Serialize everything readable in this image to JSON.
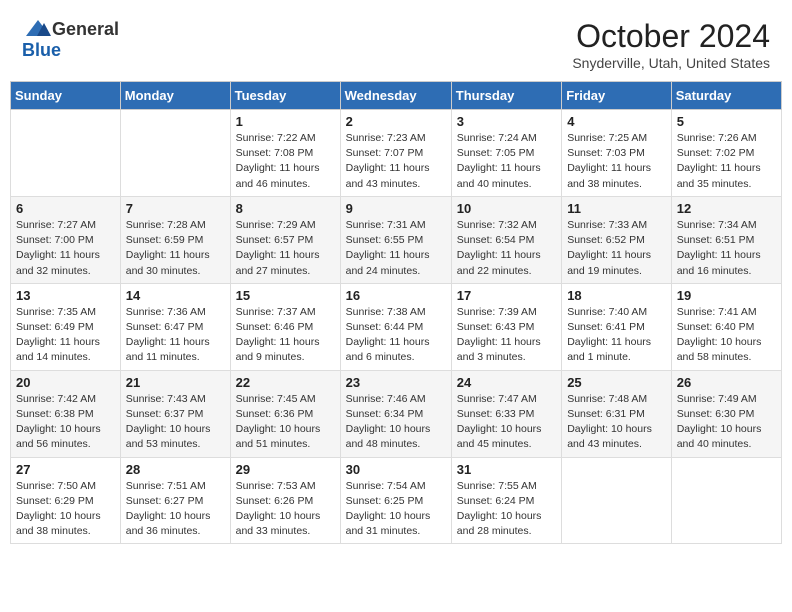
{
  "header": {
    "logo_general": "General",
    "logo_blue": "Blue",
    "month": "October 2024",
    "location": "Snyderville, Utah, United States"
  },
  "days_of_week": [
    "Sunday",
    "Monday",
    "Tuesday",
    "Wednesday",
    "Thursday",
    "Friday",
    "Saturday"
  ],
  "weeks": [
    [
      {
        "day": "",
        "info": ""
      },
      {
        "day": "",
        "info": ""
      },
      {
        "day": "1",
        "info": "Sunrise: 7:22 AM\nSunset: 7:08 PM\nDaylight: 11 hours and 46 minutes."
      },
      {
        "day": "2",
        "info": "Sunrise: 7:23 AM\nSunset: 7:07 PM\nDaylight: 11 hours and 43 minutes."
      },
      {
        "day": "3",
        "info": "Sunrise: 7:24 AM\nSunset: 7:05 PM\nDaylight: 11 hours and 40 minutes."
      },
      {
        "day": "4",
        "info": "Sunrise: 7:25 AM\nSunset: 7:03 PM\nDaylight: 11 hours and 38 minutes."
      },
      {
        "day": "5",
        "info": "Sunrise: 7:26 AM\nSunset: 7:02 PM\nDaylight: 11 hours and 35 minutes."
      }
    ],
    [
      {
        "day": "6",
        "info": "Sunrise: 7:27 AM\nSunset: 7:00 PM\nDaylight: 11 hours and 32 minutes."
      },
      {
        "day": "7",
        "info": "Sunrise: 7:28 AM\nSunset: 6:59 PM\nDaylight: 11 hours and 30 minutes."
      },
      {
        "day": "8",
        "info": "Sunrise: 7:29 AM\nSunset: 6:57 PM\nDaylight: 11 hours and 27 minutes."
      },
      {
        "day": "9",
        "info": "Sunrise: 7:31 AM\nSunset: 6:55 PM\nDaylight: 11 hours and 24 minutes."
      },
      {
        "day": "10",
        "info": "Sunrise: 7:32 AM\nSunset: 6:54 PM\nDaylight: 11 hours and 22 minutes."
      },
      {
        "day": "11",
        "info": "Sunrise: 7:33 AM\nSunset: 6:52 PM\nDaylight: 11 hours and 19 minutes."
      },
      {
        "day": "12",
        "info": "Sunrise: 7:34 AM\nSunset: 6:51 PM\nDaylight: 11 hours and 16 minutes."
      }
    ],
    [
      {
        "day": "13",
        "info": "Sunrise: 7:35 AM\nSunset: 6:49 PM\nDaylight: 11 hours and 14 minutes."
      },
      {
        "day": "14",
        "info": "Sunrise: 7:36 AM\nSunset: 6:47 PM\nDaylight: 11 hours and 11 minutes."
      },
      {
        "day": "15",
        "info": "Sunrise: 7:37 AM\nSunset: 6:46 PM\nDaylight: 11 hours and 9 minutes."
      },
      {
        "day": "16",
        "info": "Sunrise: 7:38 AM\nSunset: 6:44 PM\nDaylight: 11 hours and 6 minutes."
      },
      {
        "day": "17",
        "info": "Sunrise: 7:39 AM\nSunset: 6:43 PM\nDaylight: 11 hours and 3 minutes."
      },
      {
        "day": "18",
        "info": "Sunrise: 7:40 AM\nSunset: 6:41 PM\nDaylight: 11 hours and 1 minute."
      },
      {
        "day": "19",
        "info": "Sunrise: 7:41 AM\nSunset: 6:40 PM\nDaylight: 10 hours and 58 minutes."
      }
    ],
    [
      {
        "day": "20",
        "info": "Sunrise: 7:42 AM\nSunset: 6:38 PM\nDaylight: 10 hours and 56 minutes."
      },
      {
        "day": "21",
        "info": "Sunrise: 7:43 AM\nSunset: 6:37 PM\nDaylight: 10 hours and 53 minutes."
      },
      {
        "day": "22",
        "info": "Sunrise: 7:45 AM\nSunset: 6:36 PM\nDaylight: 10 hours and 51 minutes."
      },
      {
        "day": "23",
        "info": "Sunrise: 7:46 AM\nSunset: 6:34 PM\nDaylight: 10 hours and 48 minutes."
      },
      {
        "day": "24",
        "info": "Sunrise: 7:47 AM\nSunset: 6:33 PM\nDaylight: 10 hours and 45 minutes."
      },
      {
        "day": "25",
        "info": "Sunrise: 7:48 AM\nSunset: 6:31 PM\nDaylight: 10 hours and 43 minutes."
      },
      {
        "day": "26",
        "info": "Sunrise: 7:49 AM\nSunset: 6:30 PM\nDaylight: 10 hours and 40 minutes."
      }
    ],
    [
      {
        "day": "27",
        "info": "Sunrise: 7:50 AM\nSunset: 6:29 PM\nDaylight: 10 hours and 38 minutes."
      },
      {
        "day": "28",
        "info": "Sunrise: 7:51 AM\nSunset: 6:27 PM\nDaylight: 10 hours and 36 minutes."
      },
      {
        "day": "29",
        "info": "Sunrise: 7:53 AM\nSunset: 6:26 PM\nDaylight: 10 hours and 33 minutes."
      },
      {
        "day": "30",
        "info": "Sunrise: 7:54 AM\nSunset: 6:25 PM\nDaylight: 10 hours and 31 minutes."
      },
      {
        "day": "31",
        "info": "Sunrise: 7:55 AM\nSunset: 6:24 PM\nDaylight: 10 hours and 28 minutes."
      },
      {
        "day": "",
        "info": ""
      },
      {
        "day": "",
        "info": ""
      }
    ]
  ]
}
